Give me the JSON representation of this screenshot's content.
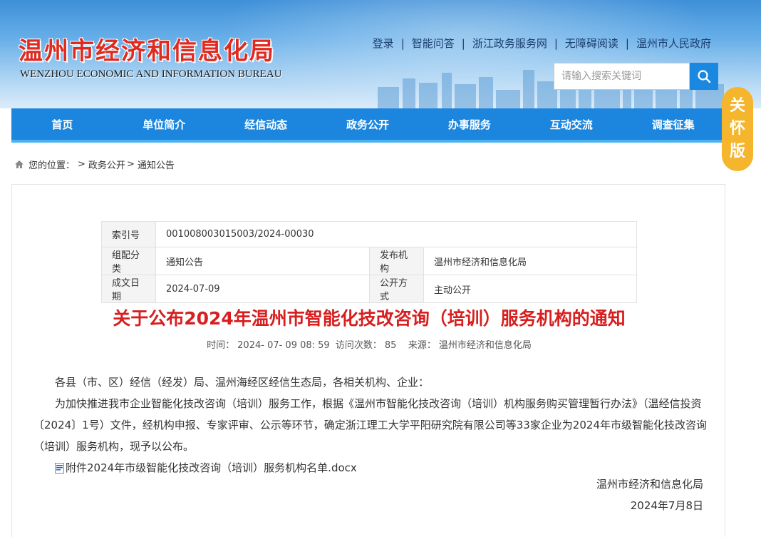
{
  "header": {
    "title": "温州市经济和信息化局",
    "subtitle": "WENZHOU ECONOMIC AND INFORMATION BUREAU",
    "links": [
      "登录",
      "智能问答",
      "浙江政务服务网",
      "无障碍阅读",
      "温州市人民政府"
    ],
    "search_placeholder": "请输入搜索关键词",
    "icons": {
      "search": "search-icon"
    }
  },
  "care_badge": {
    "chars": [
      "关",
      "怀",
      "版"
    ]
  },
  "nav": {
    "items": [
      "首页",
      "单位简介",
      "经信动态",
      "政务公开",
      "办事服务",
      "互动交流",
      "调查征集"
    ]
  },
  "breadcrumb": {
    "label": "您的位置：",
    "sep1": ">",
    "item1": "政务公开",
    "sep2": ">",
    "item2": "通知公告"
  },
  "meta": {
    "index_label": "索引号",
    "index_value": "001008003015003/2024-00030",
    "category_label": "组配分类",
    "category_value": "通知公告",
    "publisher_label": "发布机构",
    "publisher_value": "温州市经济和信息化局",
    "date_label": "成文日期",
    "date_value": "2024-07-09",
    "mode_label": "公开方式",
    "mode_value": "主动公开"
  },
  "article": {
    "title": "关于公布2024年温州市智能化技改咨询（培训）服务机构的通知",
    "time_label": "时间：",
    "time_value": "2024- 07- 09 08: 59",
    "visits_label": "访问次数：",
    "visits_value": "85",
    "source_label": "来源：",
    "source_value": "温州市经济和信息化局",
    "para1": "各县（市、区）经信（经发）局、温州海经区经信生态局，各相关机构、企业：",
    "para2": "为加快推进我市企业智能化技改咨询（培训）服务工作，根据《温州市智能化技改咨询（培训）机构服务购买管理暂行办法》（温经信投资〔2024〕1号）文件，经机构申报、专家评审、公示等环节，确定浙江理工大学平阳研究院有限公司等33家企业为2024年市级智能化技改咨询（培训）服务机构，现予以公布。",
    "attachment": "附件2024年市级智能化技改咨询（培训）服务机构名单.docx",
    "sign_org": "温州市经济和信息化局",
    "sign_date": "2024年7月8日"
  },
  "colors": {
    "nav_bg": "#1c86df",
    "title_red": "#d81e1e",
    "badge": "#f5b52d"
  }
}
